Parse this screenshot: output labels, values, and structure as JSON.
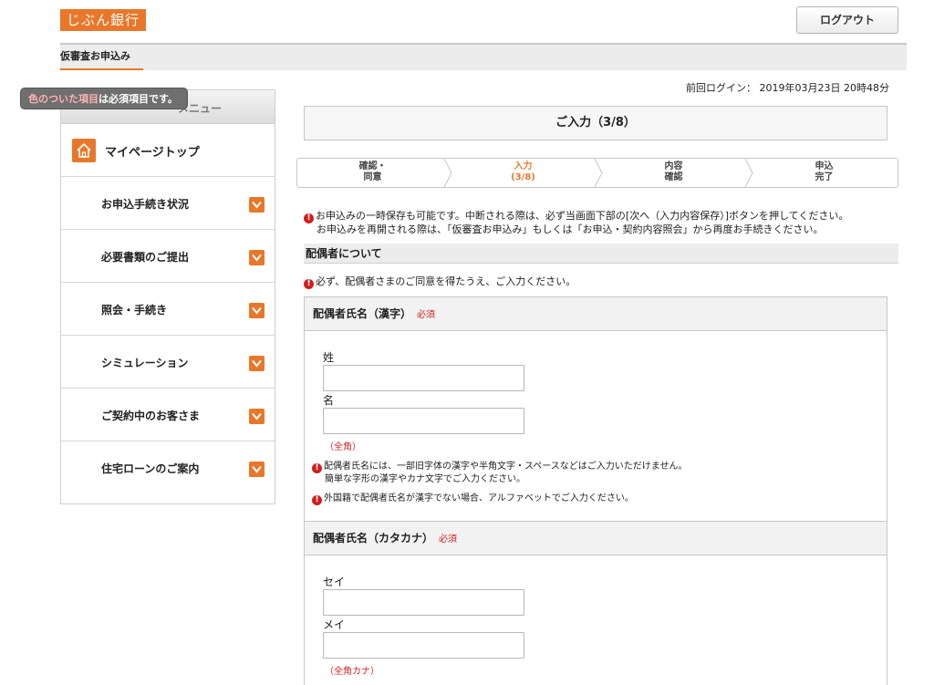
{
  "header": {
    "logo": "じぶん銀行",
    "logout_label": "ログアウト"
  },
  "tabs": [
    {
      "label": "仮審査お申込み"
    }
  ],
  "required_note": {
    "highlight": "色のついた項目",
    "rest": "は必須項目です。"
  },
  "sidebar": {
    "header": "メニュー",
    "top_label": "マイページトップ",
    "items": [
      {
        "label": "お申込手続き状況"
      },
      {
        "label": "必要書類のご提出"
      },
      {
        "label": "照会・手続き"
      },
      {
        "label": "シミュレーション"
      },
      {
        "label": "ご契約中のお客さま"
      },
      {
        "label": "住宅ローンのご案内"
      }
    ]
  },
  "last_login": "前回ログイン： 2019年03月23日 20時48分",
  "step_title": "ご入力（3/8）",
  "steps": [
    {
      "line1": "確認・",
      "line2": "同意",
      "active": false
    },
    {
      "line1": "入力",
      "line2": "(3/8)",
      "active": true
    },
    {
      "line1": "内容",
      "line2": "確認",
      "active": false
    },
    {
      "line1": "申込",
      "line2": "完了",
      "active": false
    }
  ],
  "notice": {
    "line1": "お申込みの一時保存も可能です。中断される際は、必ず当画面下部の[次へ（入力内容保存）]ボタンを押してください。",
    "line2": "お申込みを再開される際は、「仮審査お申込み」もしくは「お申込・契約内容照会」から再度お手続きください。"
  },
  "section": {
    "title": "配偶者について",
    "consent": "必ず、配偶者さまのご同意を得たうえ、ご入力ください。"
  },
  "kanji_name": {
    "title": "配偶者氏名（漢字）",
    "required": "必須",
    "last_label": "姓",
    "last_value": "",
    "first_label": "名",
    "first_value": "",
    "hint": "（全角）",
    "note1_line1": "配偶者氏名には、一部旧字体の漢字や半角文字・スペースなどはご入力いただけません。",
    "note1_line2": "簡単な字形の漢字やカナ文字でご入力ください。",
    "note2": "外国籍で配偶者氏名が漢字でない場合、アルファベットでご入力ください。"
  },
  "kana_name": {
    "title": "配偶者氏名（カタカナ）",
    "required": "必須",
    "last_label": "セイ",
    "last_value": "",
    "first_label": "メイ",
    "first_value": "",
    "hint": "（全角カナ）"
  },
  "colors": {
    "accent": "#e8772a",
    "required": "#d32020",
    "warn": "#d31d1d"
  },
  "icons": {
    "home": "home-icon",
    "chevron": "chevron-down-icon",
    "warning": "warning-icon"
  }
}
